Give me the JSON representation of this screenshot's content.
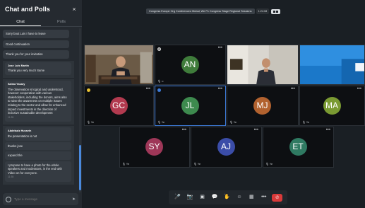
{
  "sidebar": {
    "title": "Chat and Polls",
    "close_icon": "×",
    "tabs": [
      {
        "label": "Chat",
        "active": true
      },
      {
        "label": "Polls",
        "active": false
      }
    ],
    "messages_a": [
      {
        "text": "Sorry bout Luis I have to leave"
      },
      {
        "text": "Good continuation"
      },
      {
        "text": "Thank you for your invitation"
      }
    ],
    "group_b": {
      "author": "Jose Luis Martin",
      "messages": [
        "Thank you very much Same"
      ]
    },
    "group_c": {
      "author": "Salma Yasary",
      "text": "The observation is logical and understood, however cooperation with various stakeholders, including the donors, aims also to raise the awareness on multiple issues relating to the sector and allow for enhanced impact investments in the direction of inclusive sustainable development",
      "time": "11:35"
    },
    "group_d": {
      "author": "Abdelaziz Hussein",
      "messages": [
        "the presentation is not",
        "thanks jose",
        "expand the",
        "I propose to have a photo for the whole speakers and moderators, in the end with Video on for everyone."
      ],
      "time": "11:35"
    },
    "compose_placeholder": "Type a message",
    "send_icon": "➤"
  },
  "topbar": {
    "title": "Congress Europe Org Conferences Global, We Pc Congress Stage Regional Sessions",
    "timer": "1:24:08"
  },
  "tiles": [
    {
      "id": "video1",
      "kind": "video",
      "label": ""
    },
    {
      "id": "AN",
      "initials": "AN",
      "color": "#3f7c3b",
      "mic": "🎙 ••"
    },
    {
      "id": "video2",
      "kind": "video",
      "label": ""
    },
    {
      "id": "video3",
      "kind": "video",
      "label": ""
    },
    {
      "id": "GC",
      "initials": "GC",
      "color": "#b23a4f",
      "mic": "🎙 Ye"
    },
    {
      "id": "JL",
      "initials": "JL",
      "color": "#3d8a4e",
      "mic": "🎙 Ye"
    },
    {
      "id": "MJ",
      "initials": "MJ",
      "color": "#b2622f",
      "mic": "🎙 Ye"
    },
    {
      "id": "MA",
      "initials": "MA",
      "color": "#7a9a32",
      "mic": "🎙 Ye"
    },
    {
      "id": "SY",
      "initials": "SY",
      "color": "#9e3758",
      "mic": "🎙 Ye"
    },
    {
      "id": "AJ",
      "initials": "AJ",
      "color": "#3b4da8",
      "mic": "🎙 Ye"
    },
    {
      "id": "ET",
      "initials": "ET",
      "color": "#2f7a62",
      "mic": "🎙 Ye"
    }
  ],
  "toolbar": {
    "mic_icon": "🎤",
    "camera_icon": "📷",
    "share_icon": "▣",
    "chat_icon": "💬",
    "raise_hand_icon": "✋",
    "reactions_icon": "☺",
    "grid_icon": "▦",
    "more_icon": "•••",
    "end_call_icon": "✆"
  }
}
